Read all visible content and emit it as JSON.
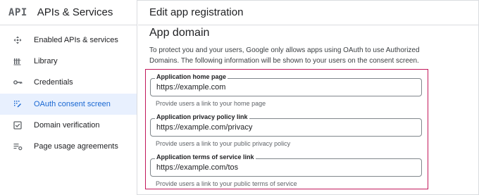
{
  "sidebar": {
    "logo": "API",
    "product": "APIs & Services",
    "items": [
      {
        "label": "Enabled APIs & services",
        "icon": "diamond-arrows-icon",
        "active": false
      },
      {
        "label": "Library",
        "icon": "library-icon",
        "active": false
      },
      {
        "label": "Credentials",
        "icon": "key-icon",
        "active": false
      },
      {
        "label": "OAuth consent screen",
        "icon": "consent-grid-icon",
        "active": true
      },
      {
        "label": "Domain verification",
        "icon": "checkbox-icon",
        "active": false
      },
      {
        "label": "Page usage agreements",
        "icon": "settings-list-icon",
        "active": false
      }
    ]
  },
  "main": {
    "header": "Edit app registration",
    "section_title": "App domain",
    "description": "To protect you and your users, Google only allows apps using OAuth to use Authorized Domains. The following information will be shown to your users on the consent screen.",
    "fields": [
      {
        "label": "Application home page",
        "value": "https://example.com",
        "hint": "Provide users a link to your home page"
      },
      {
        "label": "Application privacy policy link",
        "value": "https://example.com/privacy",
        "hint": "Provide users a link to your public privacy policy"
      },
      {
        "label": "Application terms of service link",
        "value": "https://example.com/tos",
        "hint": "Provide users a link to your public terms of service"
      }
    ]
  },
  "colors": {
    "active_bg": "#e8f0fe",
    "active_text": "#1967d2",
    "highlight_border": "#c2185b"
  }
}
